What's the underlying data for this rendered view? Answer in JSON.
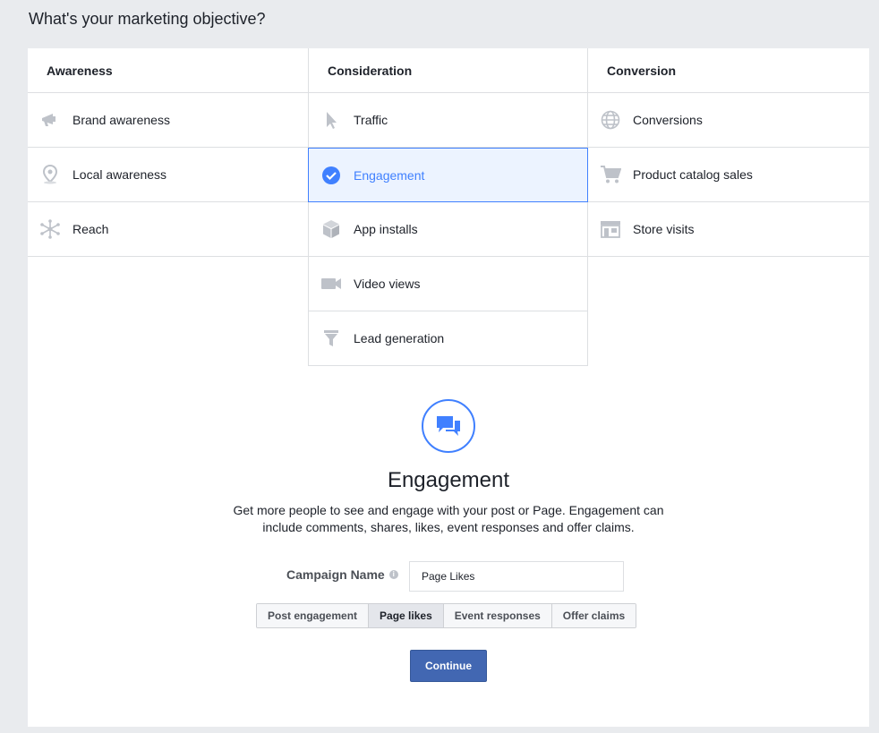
{
  "page": {
    "title": "What's your marketing objective?"
  },
  "columns": [
    {
      "header": "Awareness",
      "options": [
        {
          "label": "Brand awareness",
          "icon": "megaphone-icon"
        },
        {
          "label": "Local awareness",
          "icon": "location-pin-icon"
        },
        {
          "label": "Reach",
          "icon": "reach-icon"
        }
      ]
    },
    {
      "header": "Consideration",
      "options": [
        {
          "label": "Traffic",
          "icon": "cursor-icon"
        },
        {
          "label": "Engagement",
          "icon": "checkmark-circle-icon",
          "selected": true
        },
        {
          "label": "App installs",
          "icon": "box-icon"
        },
        {
          "label": "Video views",
          "icon": "video-camera-icon"
        },
        {
          "label": "Lead generation",
          "icon": "funnel-icon"
        }
      ]
    },
    {
      "header": "Conversion",
      "options": [
        {
          "label": "Conversions",
          "icon": "globe-icon"
        },
        {
          "label": "Product catalog sales",
          "icon": "cart-icon"
        },
        {
          "label": "Store visits",
          "icon": "store-icon"
        }
      ]
    }
  ],
  "detail": {
    "icon": "speech-bubbles-icon",
    "title": "Engagement",
    "description": "Get more people to see and engage with your post or Page. Engagement can include comments, shares, likes, event responses and offer claims.",
    "campaign_label": "Campaign Name",
    "campaign_value": "Page Likes",
    "segments": [
      "Post engagement",
      "Page likes",
      "Event responses",
      "Offer claims"
    ],
    "active_segment": "Page likes",
    "continue_label": "Continue"
  },
  "colors": {
    "accent": "#4080ff",
    "button": "#4267b2",
    "icon_gray": "#bec2c9"
  }
}
